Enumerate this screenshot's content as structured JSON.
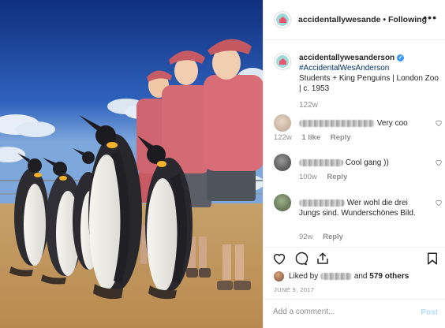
{
  "header": {
    "username": "accidentallywesande",
    "separator": "•",
    "follow_status": "Following",
    "more_icon": "more-horizontal-icon"
  },
  "caption": {
    "username": "accidentallywesanderson",
    "verified": true,
    "hashtag": "#AccidentalWesAnderson",
    "text": "Students + King Penguins | London Zoo | c. 1953",
    "time": "122w"
  },
  "comments": [
    {
      "text": "Very coo",
      "time": "122w",
      "likes": "1 like",
      "reply": "Reply"
    },
    {
      "text": "Cool gang ))",
      "time": "100w",
      "likes": "",
      "reply": "Reply"
    },
    {
      "text": "Wer wohl die drei Jungs sind. Wunderschönes Bild.",
      "time": "92w",
      "likes": "",
      "reply": "Reply"
    }
  ],
  "actions": {
    "like_icon": "heart-icon",
    "comment_icon": "comment-icon",
    "share_icon": "share-icon",
    "save_icon": "bookmark-icon",
    "liked_by_prefix": "Liked by",
    "liked_by_and": "and",
    "liked_count": "579 others",
    "date": "JUNE 9, 2017"
  },
  "add_comment": {
    "placeholder": "Add a comment...",
    "post_label": "Post"
  },
  "colors": {
    "link": "#003569",
    "verified": "#3897f0",
    "post_disabled": "#b2dffc",
    "muted": "#8e8e8e"
  }
}
